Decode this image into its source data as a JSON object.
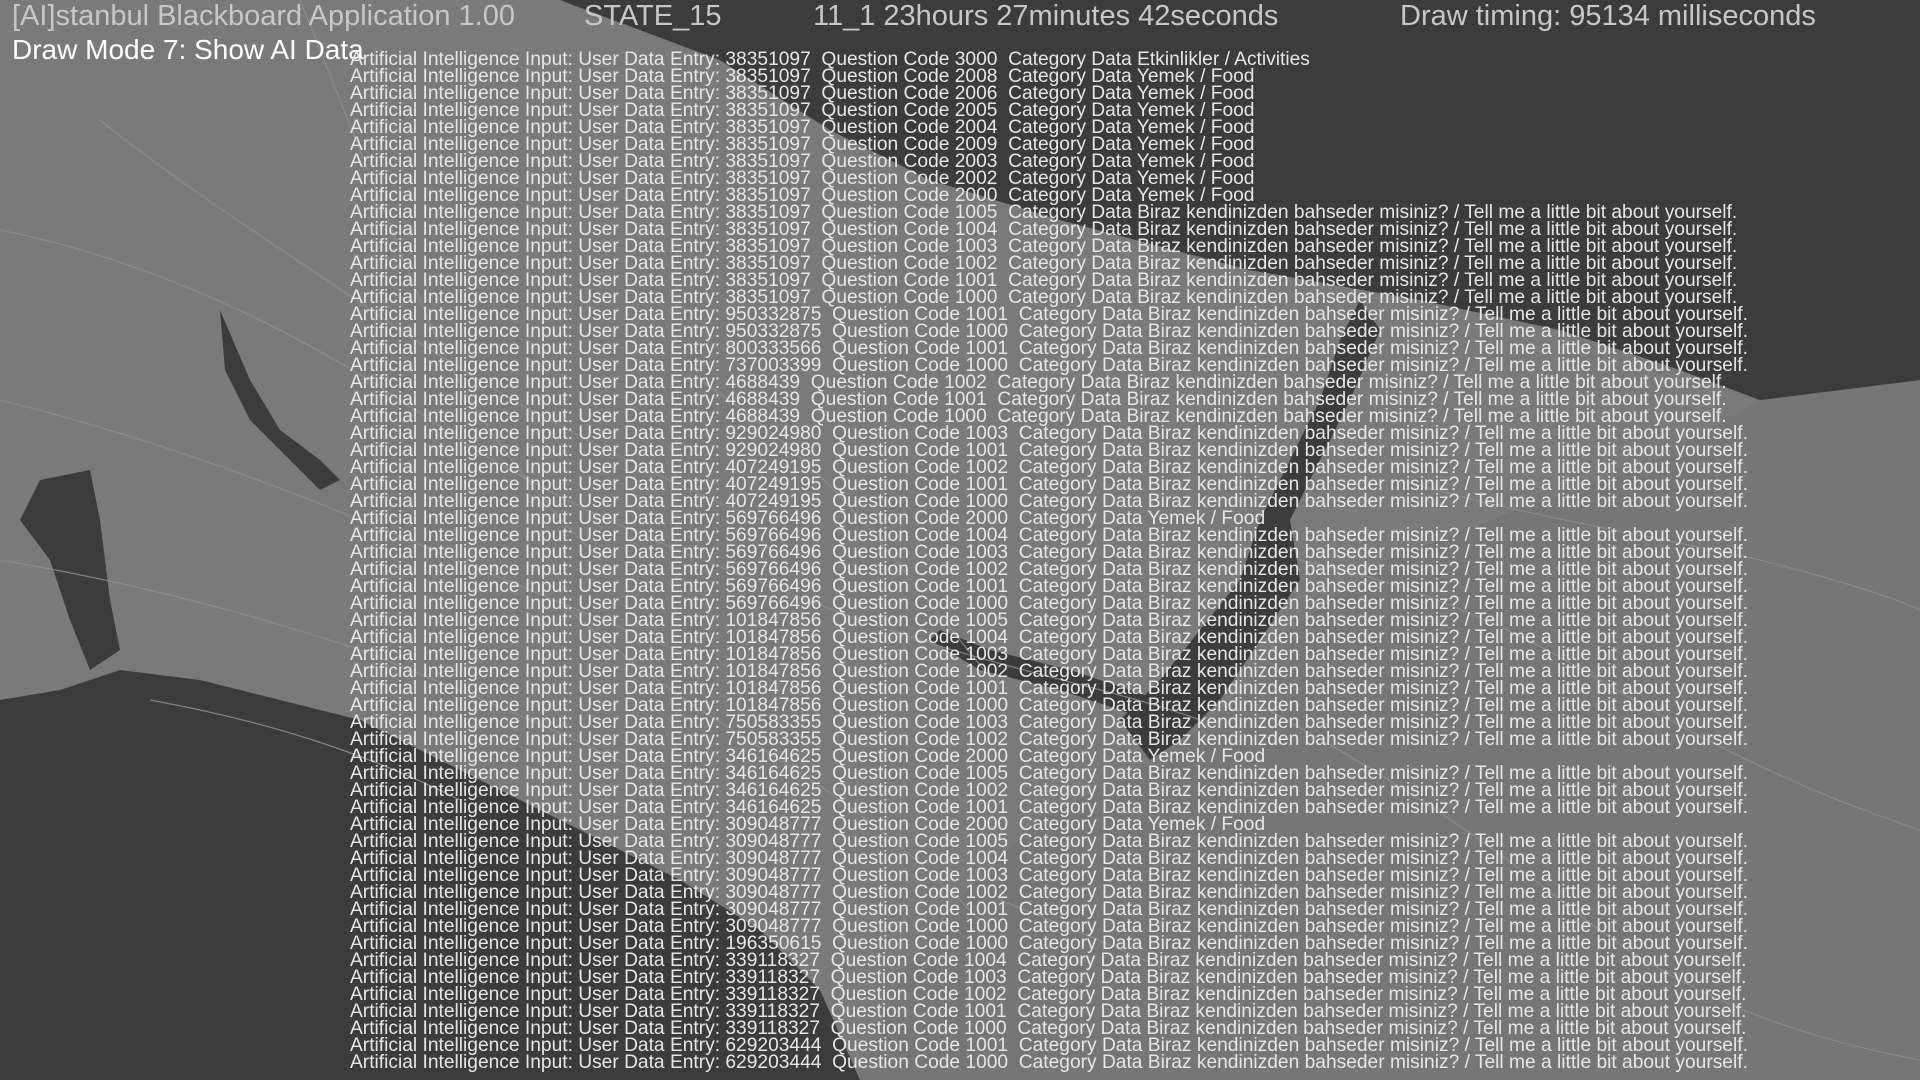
{
  "header": {
    "app_title": "[AI]stanbul Blackboard Application 1.00",
    "state": "STATE_15",
    "time": "11_1  23hours 27minutes 42seconds",
    "draw_timing": "Draw timing: 95134 milliseconds",
    "draw_mode": "Draw Mode 7: Show AI Data"
  },
  "map": {
    "background_color": "#3c3c3c",
    "land_color": "#7a7a7a",
    "road_color": "#8c8c8c"
  },
  "log": {
    "prefix": "Artificial Intelligence Input: User Data Entry:",
    "question_label": "Question Code",
    "category_label": "Category Data",
    "text_color": "#e6e6e6",
    "entries": [
      {
        "entry": "38351097",
        "code": "3000",
        "category": "Etkinlikler / Activities"
      },
      {
        "entry": "38351097",
        "code": "2008",
        "category": "Yemek / Food"
      },
      {
        "entry": "38351097",
        "code": "2006",
        "category": "Yemek / Food"
      },
      {
        "entry": "38351097",
        "code": "2005",
        "category": "Yemek / Food"
      },
      {
        "entry": "38351097",
        "code": "2004",
        "category": "Yemek / Food"
      },
      {
        "entry": "38351097",
        "code": "2009",
        "category": "Yemek / Food"
      },
      {
        "entry": "38351097",
        "code": "2003",
        "category": "Yemek / Food"
      },
      {
        "entry": "38351097",
        "code": "2002",
        "category": "Yemek / Food"
      },
      {
        "entry": "38351097",
        "code": "2000",
        "category": "Yemek / Food"
      },
      {
        "entry": "38351097",
        "code": "1005",
        "category": "Biraz kendinizden bahseder misiniz? / Tell me a little bit about yourself."
      },
      {
        "entry": "38351097",
        "code": "1004",
        "category": "Biraz kendinizden bahseder misiniz? / Tell me a little bit about yourself."
      },
      {
        "entry": "38351097",
        "code": "1003",
        "category": "Biraz kendinizden bahseder misiniz? / Tell me a little bit about yourself."
      },
      {
        "entry": "38351097",
        "code": "1002",
        "category": "Biraz kendinizden bahseder misiniz? / Tell me a little bit about yourself."
      },
      {
        "entry": "38351097",
        "code": "1001",
        "category": "Biraz kendinizden bahseder misiniz? / Tell me a little bit about yourself."
      },
      {
        "entry": "38351097",
        "code": "1000",
        "category": "Biraz kendinizden bahseder misiniz? / Tell me a little bit about yourself."
      },
      {
        "entry": "950332875",
        "code": "1001",
        "category": "Biraz kendinizden bahseder misiniz? / Tell me a little bit about yourself."
      },
      {
        "entry": "950332875",
        "code": "1000",
        "category": "Biraz kendinizden bahseder misiniz? / Tell me a little bit about yourself."
      },
      {
        "entry": "800333566",
        "code": "1001",
        "category": "Biraz kendinizden bahseder misiniz? / Tell me a little bit about yourself."
      },
      {
        "entry": "737003399",
        "code": "1000",
        "category": "Biraz kendinizden bahseder misiniz? / Tell me a little bit about yourself."
      },
      {
        "entry": "4688439",
        "code": "1002",
        "category": "Biraz kendinizden bahseder misiniz? / Tell me a little bit about yourself."
      },
      {
        "entry": "4688439",
        "code": "1001",
        "category": "Biraz kendinizden bahseder misiniz? / Tell me a little bit about yourself."
      },
      {
        "entry": "4688439",
        "code": "1000",
        "category": "Biraz kendinizden bahseder misiniz? / Tell me a little bit about yourself."
      },
      {
        "entry": "929024980",
        "code": "1003",
        "category": "Biraz kendinizden bahseder misiniz? / Tell me a little bit about yourself."
      },
      {
        "entry": "929024980",
        "code": "1001",
        "category": "Biraz kendinizden bahseder misiniz? / Tell me a little bit about yourself."
      },
      {
        "entry": "407249195",
        "code": "1002",
        "category": "Biraz kendinizden bahseder misiniz? / Tell me a little bit about yourself."
      },
      {
        "entry": "407249195",
        "code": "1001",
        "category": "Biraz kendinizden bahseder misiniz? / Tell me a little bit about yourself."
      },
      {
        "entry": "407249195",
        "code": "1000",
        "category": "Biraz kendinizden bahseder misiniz? / Tell me a little bit about yourself."
      },
      {
        "entry": "569766496",
        "code": "2000",
        "category": "Yemek / Food"
      },
      {
        "entry": "569766496",
        "code": "1004",
        "category": "Biraz kendinizden bahseder misiniz? / Tell me a little bit about yourself."
      },
      {
        "entry": "569766496",
        "code": "1003",
        "category": "Biraz kendinizden bahseder misiniz? / Tell me a little bit about yourself."
      },
      {
        "entry": "569766496",
        "code": "1002",
        "category": "Biraz kendinizden bahseder misiniz? / Tell me a little bit about yourself."
      },
      {
        "entry": "569766496",
        "code": "1001",
        "category": "Biraz kendinizden bahseder misiniz? / Tell me a little bit about yourself."
      },
      {
        "entry": "569766496",
        "code": "1000",
        "category": "Biraz kendinizden bahseder misiniz? / Tell me a little bit about yourself."
      },
      {
        "entry": "101847856",
        "code": "1005",
        "category": "Biraz kendinizden bahseder misiniz? / Tell me a little bit about yourself."
      },
      {
        "entry": "101847856",
        "code": "1004",
        "category": "Biraz kendinizden bahseder misiniz? / Tell me a little bit about yourself."
      },
      {
        "entry": "101847856",
        "code": "1003",
        "category": "Biraz kendinizden bahseder misiniz? / Tell me a little bit about yourself."
      },
      {
        "entry": "101847856",
        "code": "1002",
        "category": "Biraz kendinizden bahseder misiniz? / Tell me a little bit about yourself."
      },
      {
        "entry": "101847856",
        "code": "1001",
        "category": "Biraz kendinizden bahseder misiniz? / Tell me a little bit about yourself."
      },
      {
        "entry": "101847856",
        "code": "1000",
        "category": "Biraz kendinizden bahseder misiniz? / Tell me a little bit about yourself."
      },
      {
        "entry": "750583355",
        "code": "1003",
        "category": "Biraz kendinizden bahseder misiniz? / Tell me a little bit about yourself."
      },
      {
        "entry": "750583355",
        "code": "1002",
        "category": "Biraz kendinizden bahseder misiniz? / Tell me a little bit about yourself."
      },
      {
        "entry": "346164625",
        "code": "2000",
        "category": "Yemek / Food"
      },
      {
        "entry": "346164625",
        "code": "1005",
        "category": "Biraz kendinizden bahseder misiniz? / Tell me a little bit about yourself."
      },
      {
        "entry": "346164625",
        "code": "1002",
        "category": "Biraz kendinizden bahseder misiniz? / Tell me a little bit about yourself."
      },
      {
        "entry": "346164625",
        "code": "1001",
        "category": "Biraz kendinizden bahseder misiniz? / Tell me a little bit about yourself."
      },
      {
        "entry": "309048777",
        "code": "2000",
        "category": "Yemek / Food"
      },
      {
        "entry": "309048777",
        "code": "1005",
        "category": "Biraz kendinizden bahseder misiniz? / Tell me a little bit about yourself."
      },
      {
        "entry": "309048777",
        "code": "1004",
        "category": "Biraz kendinizden bahseder misiniz? / Tell me a little bit about yourself."
      },
      {
        "entry": "309048777",
        "code": "1003",
        "category": "Biraz kendinizden bahseder misiniz? / Tell me a little bit about yourself."
      },
      {
        "entry": "309048777",
        "code": "1002",
        "category": "Biraz kendinizden bahseder misiniz? / Tell me a little bit about yourself."
      },
      {
        "entry": "309048777",
        "code": "1001",
        "category": "Biraz kendinizden bahseder misiniz? / Tell me a little bit about yourself."
      },
      {
        "entry": "309048777",
        "code": "1000",
        "category": "Biraz kendinizden bahseder misiniz? / Tell me a little bit about yourself."
      },
      {
        "entry": "196350615",
        "code": "1000",
        "category": "Biraz kendinizden bahseder misiniz? / Tell me a little bit about yourself."
      },
      {
        "entry": "339118327",
        "code": "1004",
        "category": "Biraz kendinizden bahseder misiniz? / Tell me a little bit about yourself."
      },
      {
        "entry": "339118327",
        "code": "1003",
        "category": "Biraz kendinizden bahseder misiniz? / Tell me a little bit about yourself."
      },
      {
        "entry": "339118327",
        "code": "1002",
        "category": "Biraz kendinizden bahseder misiniz? / Tell me a little bit about yourself."
      },
      {
        "entry": "339118327",
        "code": "1001",
        "category": "Biraz kendinizden bahseder misiniz? / Tell me a little bit about yourself."
      },
      {
        "entry": "339118327",
        "code": "1000",
        "category": "Biraz kendinizden bahseder misiniz? / Tell me a little bit about yourself."
      },
      {
        "entry": "629203444",
        "code": "1001",
        "category": "Biraz kendinizden bahseder misiniz? / Tell me a little bit about yourself."
      },
      {
        "entry": "629203444",
        "code": "1000",
        "category": "Biraz kendinizden bahseder misiniz? / Tell me a little bit about yourself."
      }
    ]
  }
}
